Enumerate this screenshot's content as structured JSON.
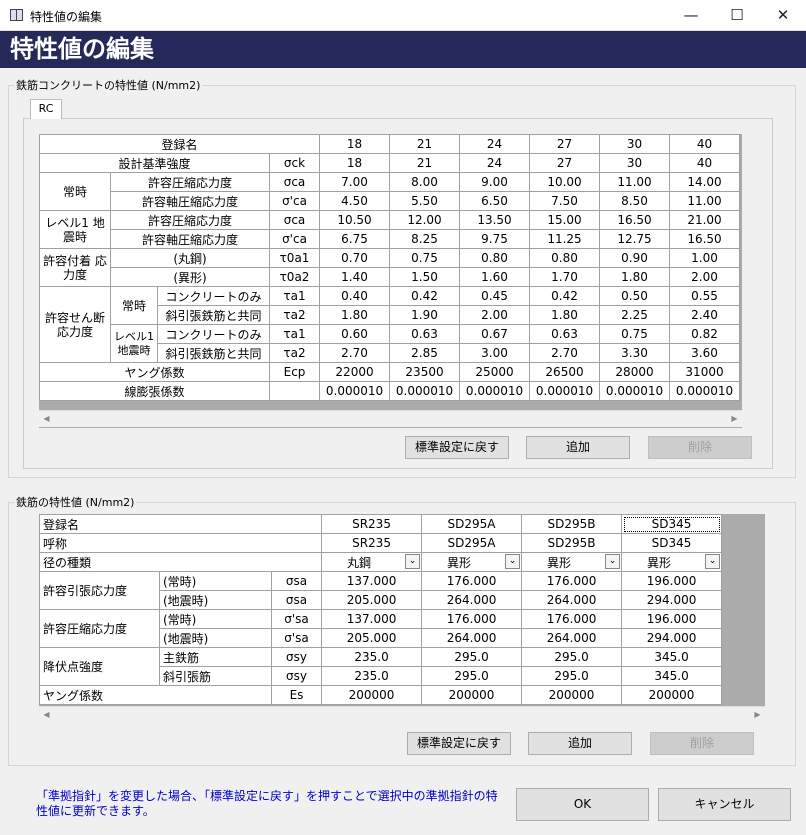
{
  "window": {
    "title": "特性値の編集",
    "minimize": "—",
    "maximize": "☐",
    "close": "✕"
  },
  "header": {
    "title": "特性値の編集"
  },
  "rc_group": {
    "title": "鉄筋コンクリートの特性値 (N/mm2)",
    "tab": "RC"
  },
  "rc_table": {
    "rows": [
      [
        "登録名",
        "",
        "18",
        "21",
        "24",
        "27",
        "30",
        "40"
      ],
      [
        "設計基準強度",
        "σck",
        "18",
        "21",
        "24",
        "27",
        "30",
        "40"
      ],
      [
        "常時",
        "許容圧縮応力度",
        "σca",
        "7.00",
        "8.00",
        "9.00",
        "10.00",
        "11.00",
        "14.00"
      ],
      [
        "許容軸圧縮応力度",
        "σ'ca",
        "4.50",
        "5.50",
        "6.50",
        "7.50",
        "8.50",
        "11.00"
      ],
      [
        "レベル1 地震時",
        "許容圧縮応力度",
        "σca",
        "10.50",
        "12.00",
        "13.50",
        "15.00",
        "16.50",
        "21.00"
      ],
      [
        "許容軸圧縮応力度",
        "σ'ca",
        "6.75",
        "8.25",
        "9.75",
        "11.25",
        "12.75",
        "16.50"
      ],
      [
        "許容付着 応力度",
        "(丸鋼)",
        "τ0a1",
        "0.70",
        "0.75",
        "0.80",
        "0.80",
        "0.90",
        "1.00"
      ],
      [
        "(異形)",
        "τ0a2",
        "1.40",
        "1.50",
        "1.60",
        "1.70",
        "1.80",
        "2.00"
      ],
      [
        "許容せん断 応力度",
        "常時",
        "コンクリートのみ",
        "τa1",
        "0.40",
        "0.42",
        "0.45",
        "0.42",
        "0.50",
        "0.55"
      ],
      [
        "斜引張鉄筋と共同",
        "τa2",
        "1.80",
        "1.90",
        "2.00",
        "1.80",
        "2.25",
        "2.40"
      ],
      [
        "レベル1 地震時",
        "コンクリートのみ",
        "τa1",
        "0.60",
        "0.63",
        "0.67",
        "0.63",
        "0.75",
        "0.82"
      ],
      [
        "斜引張鉄筋と共同",
        "τa2",
        "2.70",
        "2.85",
        "3.00",
        "2.70",
        "3.30",
        "3.60"
      ],
      [
        "ヤング係数",
        "Ecp",
        "22000",
        "23500",
        "25000",
        "26500",
        "28000",
        "31000"
      ],
      [
        "線膨張係数",
        "",
        "0.000010",
        "0.000010",
        "0.000010",
        "0.000010",
        "0.000010",
        "0.000010"
      ]
    ]
  },
  "rc_buttons": {
    "reset": "標準設定に戻す",
    "add": "追加",
    "delete": "削除"
  },
  "rebar_group": {
    "title": "鉄筋の特性値 (N/mm2)"
  },
  "rebar_table": {
    "rows": [
      [
        "登録名",
        "SR235",
        "SD295A",
        "SD295B",
        "SD345"
      ],
      [
        "呼称",
        "SR235",
        "SD295A",
        "SD295B",
        "SD345"
      ],
      [
        "径の種類",
        "丸鋼",
        "異形",
        "異形",
        "異形"
      ],
      [
        "許容引張応力度",
        "(常時)",
        "σsa",
        "137.000",
        "176.000",
        "176.000",
        "196.000"
      ],
      [
        "(地震時)",
        "σsa",
        "205.000",
        "264.000",
        "264.000",
        "294.000"
      ],
      [
        "許容圧縮応力度",
        "(常時)",
        "σ'sa",
        "137.000",
        "176.000",
        "176.000",
        "196.000"
      ],
      [
        "(地震時)",
        "σ'sa",
        "205.000",
        "264.000",
        "264.000",
        "294.000"
      ],
      [
        "降伏点強度",
        "主鉄筋",
        "σsy",
        "235.0",
        "295.0",
        "295.0",
        "345.0"
      ],
      [
        "斜引張筋",
        "σsy",
        "235.0",
        "295.0",
        "295.0",
        "345.0"
      ],
      [
        "ヤング係数",
        "Es",
        "200000",
        "200000",
        "200000",
        "200000"
      ]
    ]
  },
  "rebar_buttons": {
    "reset": "標準設定に戻す",
    "add": "追加",
    "delete": "削除"
  },
  "footer": {
    "note": "「準拠指針」を変更した場合、「標準設定に戻す」を押すことで選択中の準拠指針の特性値に更新できます。",
    "ok": "OK",
    "cancel": "キャンセル"
  }
}
